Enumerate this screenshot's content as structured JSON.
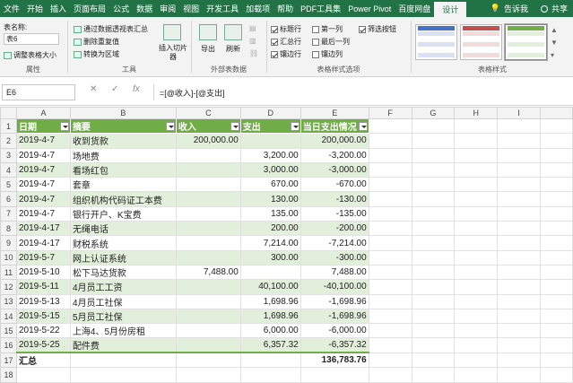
{
  "tabs": [
    "文件",
    "开始",
    "插入",
    "页面布局",
    "公式",
    "数据",
    "审阅",
    "视图",
    "开发工具",
    "加载项",
    "帮助",
    "PDF工具集",
    "Power Pivot",
    "百度网盘",
    "设计"
  ],
  "tab_right": {
    "lightbulb": "💡",
    "tell": "告诉我",
    "share": "共享"
  },
  "ribbon": {
    "props": {
      "name_label": "表名称:",
      "name_value": "表6",
      "resize": "调整表格大小",
      "label": "属性"
    },
    "tools": {
      "pivot": "通过数据透视表汇总",
      "dedupe": "删除重复值",
      "convert": "转换为区域",
      "slicer": "插入切片器",
      "label": "工具"
    },
    "external": {
      "export": "导出",
      "refresh": "刷新",
      "label": "外部表数据"
    },
    "options": {
      "header_row": "标题行",
      "total_row": "汇总行",
      "banded_rows": "镶边行",
      "first_col": "第一列",
      "last_col": "最后一列",
      "banded_cols": "镶边列",
      "filter_btn": "筛选按钮",
      "label": "表格样式选项"
    },
    "styles": {
      "label": "表格样式"
    }
  },
  "formula": {
    "cell": "E6",
    "fx": "fx",
    "cancel": "✕",
    "enter": "✓",
    "value": "=[@收入]-[@支出]"
  },
  "columns": [
    "",
    "A",
    "B",
    "C",
    "D",
    "E",
    "F",
    "G",
    "H",
    "I"
  ],
  "headers": [
    "日期",
    "摘要",
    "收入",
    "支出",
    "当日支出情况"
  ],
  "rows": [
    [
      "2019-4-7",
      "收到货款",
      "200,000.00",
      "",
      "200,000.00"
    ],
    [
      "2019-4-7",
      "场地费",
      "",
      "3,200.00",
      "-3,200.00"
    ],
    [
      "2019-4-7",
      "看场红包",
      "",
      "3,000.00",
      "-3,000.00"
    ],
    [
      "2019-4-7",
      "套章",
      "",
      "670.00",
      "-670.00"
    ],
    [
      "2019-4-7",
      "组织机构代码证工本费",
      "",
      "130.00",
      "-130.00"
    ],
    [
      "2019-4-7",
      "银行开户、K宝费",
      "",
      "135.00",
      "-135.00"
    ],
    [
      "2019-4-17",
      "无绳电话",
      "",
      "200.00",
      "-200.00"
    ],
    [
      "2019-4-17",
      "财税系统",
      "",
      "7,214.00",
      "-7,214.00"
    ],
    [
      "2019-5-7",
      "网上认证系统",
      "",
      "300.00",
      "-300.00"
    ],
    [
      "2019-5-10",
      "松下马达货款",
      "7,488.00",
      "",
      "7,488.00"
    ],
    [
      "2019-5-11",
      "4月员工工资",
      "",
      "40,100.00",
      "-40,100.00"
    ],
    [
      "2019-5-13",
      "4月员工社保",
      "",
      "1,698.96",
      "-1,698.96"
    ],
    [
      "2019-5-15",
      "5月员工社保",
      "",
      "1,698.96",
      "-1,698.96"
    ],
    [
      "2019-5-22",
      "上海4、5月份房租",
      "",
      "6,000.00",
      "-6,000.00"
    ],
    [
      "2019-5-25",
      "配件费",
      "",
      "6,357.32",
      "-6,357.32"
    ]
  ],
  "total": {
    "label": "汇总",
    "value": "136,783.76"
  },
  "row_numbers": [
    "1",
    "2",
    "3",
    "4",
    "5",
    "6",
    "7",
    "8",
    "9",
    "10",
    "11",
    "12",
    "13",
    "14",
    "15",
    "16",
    "17",
    "18"
  ],
  "colors": {
    "accent": "#217346",
    "table_header": "#70ad47",
    "band": "#e2efda"
  }
}
